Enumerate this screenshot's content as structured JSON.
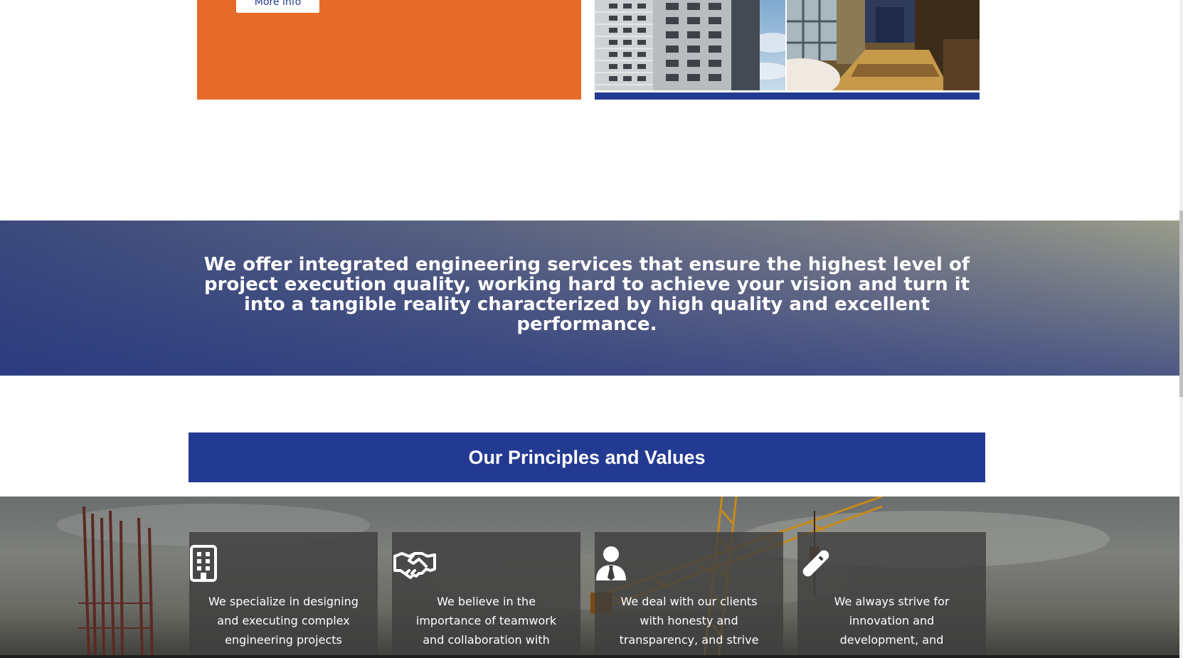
{
  "top": {
    "more_info_label": "More info"
  },
  "banner": {
    "text": "We offer integrated engineering services that ensure the highest level of project execution quality, working hard to achieve your vision and turn it into a tangible reality characterized by high quality and excellent performance."
  },
  "principles": {
    "title": "Our Principles and Values",
    "cards": [
      {
        "icon": "building-icon",
        "text": "We specialize in designing and executing complex engineering projects"
      },
      {
        "icon": "handshake-icon",
        "text": "We believe in the importance of teamwork and collaboration with"
      },
      {
        "icon": "businessman-icon",
        "text": "We deal with our clients with honesty and transparency, and strive"
      },
      {
        "icon": "pencil-icon",
        "text": "We always strive for innovation and development, and"
      }
    ]
  },
  "colors": {
    "accent_orange": "#e66a28",
    "brand_blue": "#233a92"
  }
}
